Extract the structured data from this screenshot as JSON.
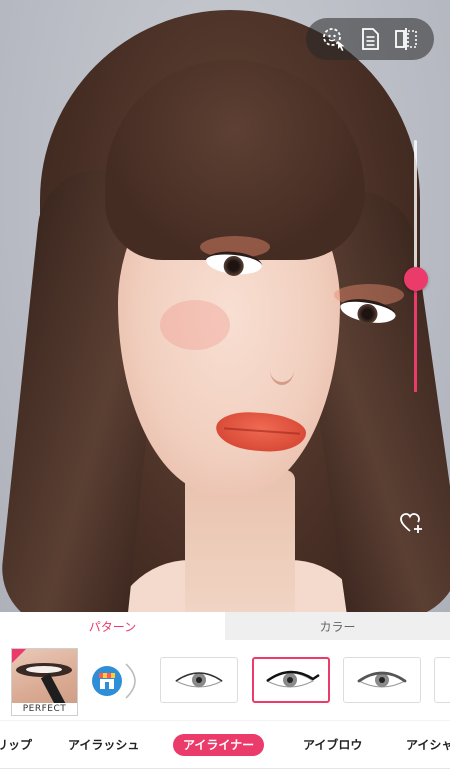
{
  "toolbar": {
    "buttons": [
      {
        "icon": "face-detect-icon"
      },
      {
        "icon": "document-icon"
      },
      {
        "icon": "compare-icon"
      }
    ]
  },
  "slider": {
    "value_percent": 45,
    "accent_color": "#ea3b6a"
  },
  "favorite": {
    "icon": "heart-plus-icon"
  },
  "tabs": [
    {
      "label": "パターン",
      "active": true
    },
    {
      "label": "カラー",
      "active": false
    }
  ],
  "patterns": {
    "perfect_label": "PERFECT",
    "store_icon": "store-icon",
    "refresh_icon": "refresh-arc-icon",
    "items": [
      {
        "style": "eyeliner-thin",
        "selected": false
      },
      {
        "style": "eyeliner-wing",
        "selected": true
      },
      {
        "style": "eyeliner-soft",
        "selected": false
      },
      {
        "style": "eyeliner-partial",
        "selected": false
      }
    ]
  },
  "categories": {
    "items": [
      {
        "label": "リップ",
        "active": false
      },
      {
        "label": "アイラッシュ",
        "active": false
      },
      {
        "label": "アイライナー",
        "active": true
      },
      {
        "label": "アイブロウ",
        "active": false
      },
      {
        "label": "アイシャ",
        "active": false
      }
    ]
  },
  "colors": {
    "accent": "#ea3b6a",
    "tab_inactive_bg": "#efefef"
  }
}
